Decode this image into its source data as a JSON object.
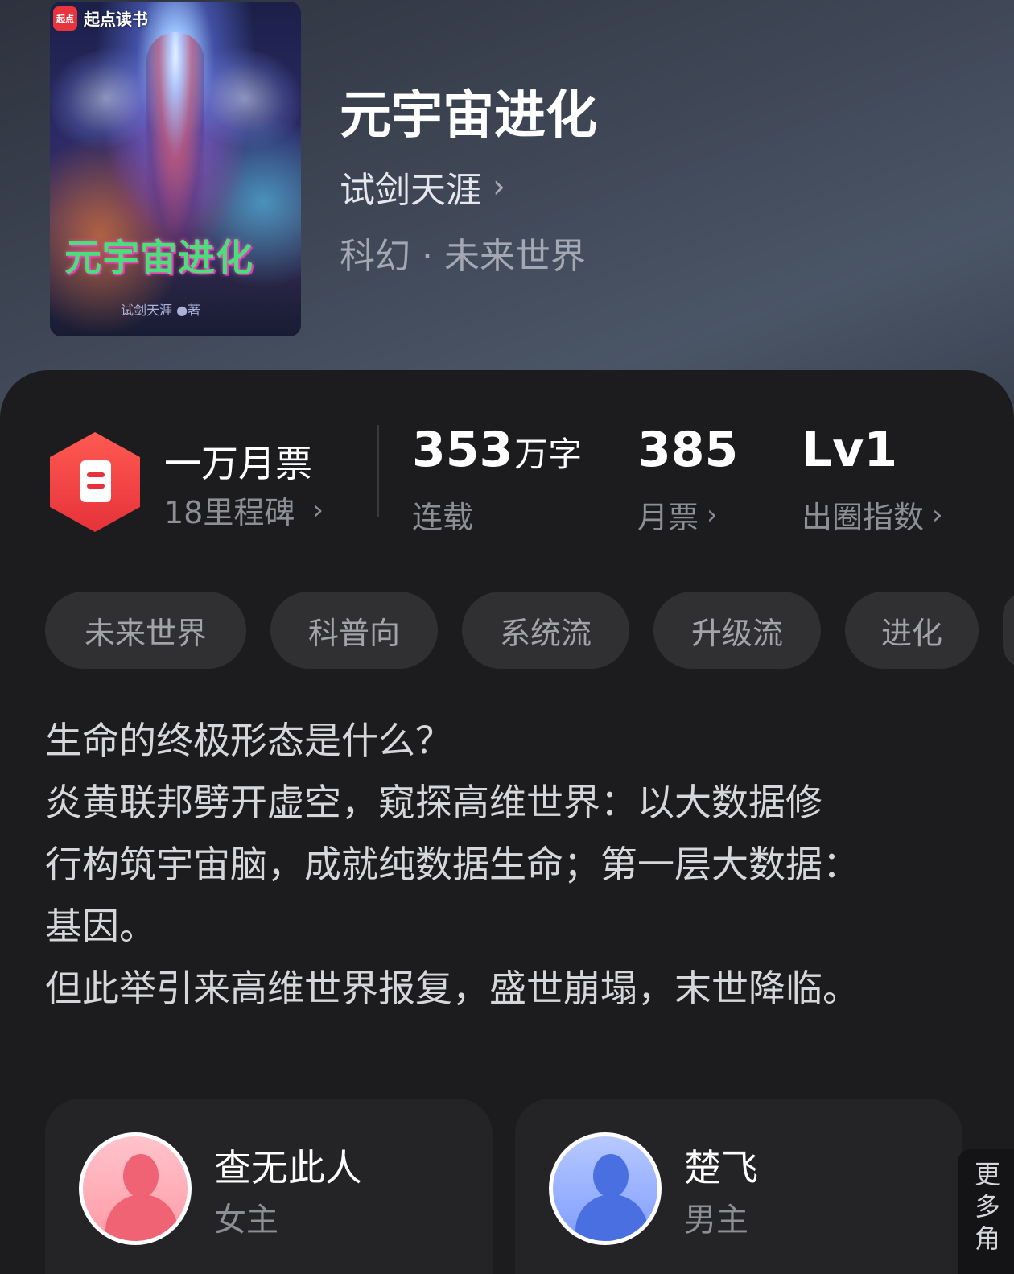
{
  "cover": {
    "brand_badge": "起点",
    "brand": "起点读书",
    "title_art": "元宇宙进化",
    "author_art": "试剑天涯 ●著"
  },
  "book": {
    "title": "元宇宙进化",
    "author": "试剑天涯",
    "genre": "科幻 · 未来世界"
  },
  "stats": {
    "honor_title": "一万月票",
    "honor_sub": "18里程碑",
    "word_count": "353",
    "word_unit": "万字",
    "word_label": "连载",
    "monthly_votes": "385",
    "monthly_votes_label": "月票",
    "level": "Lv1",
    "level_label": "出圈指数"
  },
  "tags": [
    "未来世界",
    "科普向",
    "系统流",
    "升级流",
    "进化"
  ],
  "description": [
    "生命的终极形态是什么？",
    "炎黄联邦劈开虚空，窥探高维世界：以大数据修",
    "行构筑宇宙脑，成就纯数据生命；第一层大数据：",
    "基因。",
    "但此举引来高维世界报复，盛世崩塌，末世降临。"
  ],
  "characters": [
    {
      "name": "查无此人",
      "role": "女主"
    },
    {
      "name": "楚飞",
      "role": "男主"
    }
  ],
  "more_characters": "更多角",
  "icons": {
    "chevron": "chevron-right-icon",
    "ticket": "ticket-hexagon-icon"
  },
  "colors": {
    "accent_red": "#e6323a",
    "background": "#1c1c1e",
    "tag_bg": "#303032"
  }
}
